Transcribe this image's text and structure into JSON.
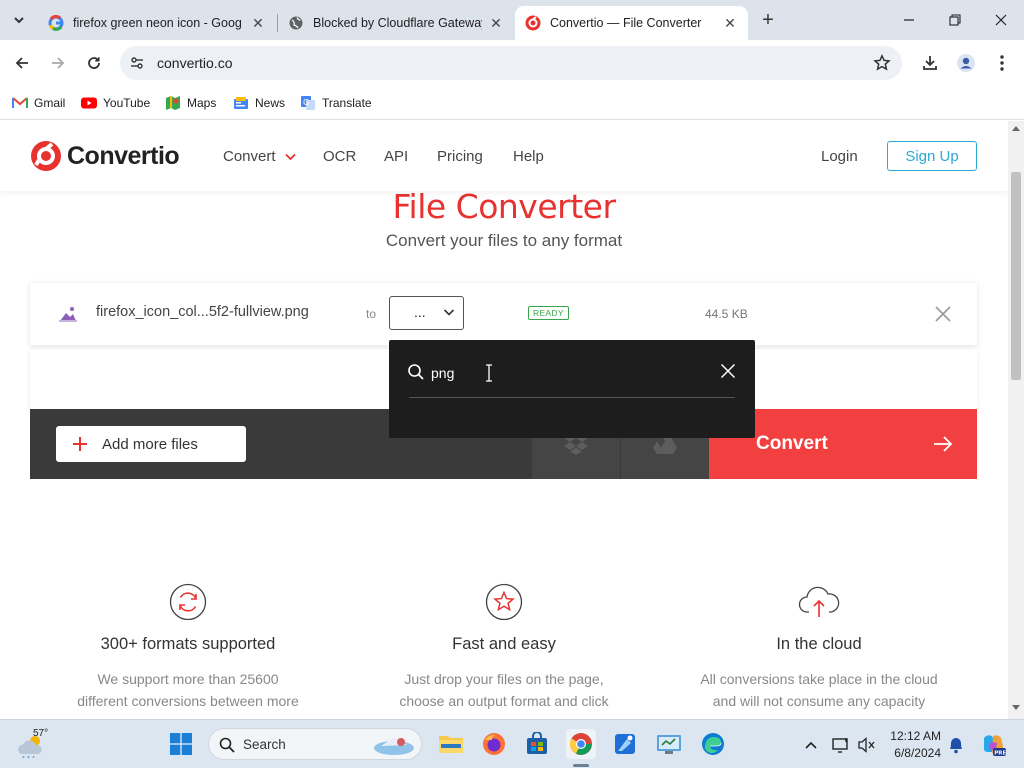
{
  "browser": {
    "tabs": [
      {
        "title": "firefox green neon icon - Goog",
        "favicon": "google-icon",
        "active": false
      },
      {
        "title": "Blocked by Cloudflare Gateway",
        "favicon": "globe-icon",
        "active": false
      },
      {
        "title": "Convertio — File Converter",
        "favicon": "convertio-icon",
        "active": true
      }
    ],
    "url": "convertio.co",
    "bookmarks": [
      {
        "label": "Gmail",
        "icon": "gmail-icon"
      },
      {
        "label": "YouTube",
        "icon": "youtube-icon"
      },
      {
        "label": "Maps",
        "icon": "maps-icon"
      },
      {
        "label": "News",
        "icon": "news-icon"
      },
      {
        "label": "Translate",
        "icon": "translate-icon"
      }
    ]
  },
  "site": {
    "brand": "Convertio",
    "nav": [
      "Convert",
      "OCR",
      "API",
      "Pricing",
      "Help"
    ],
    "login": "Login",
    "signup": "Sign Up",
    "hero_title": "File Converter",
    "hero_subtitle": "Convert your files to any format",
    "file": {
      "name": "firefox_icon_col...5f2-fullview.png",
      "to_label": "to",
      "format_value": "...",
      "status": "READY",
      "size": "44.5 KB"
    },
    "add_more": "Add more files",
    "convert": "Convert",
    "format_search": {
      "query": "png"
    },
    "features": [
      {
        "title": "300+ formats supported",
        "line1": "We support more than 25600",
        "line2": "different conversions between more",
        "icon": "refresh-circle-icon"
      },
      {
        "title": "Fast and easy",
        "line1": "Just drop your files on the page,",
        "line2": "choose an output format and click",
        "icon": "star-circle-icon"
      },
      {
        "title": "In the cloud",
        "line1": "All conversions take place in the cloud",
        "line2": "and will not consume any capacity",
        "icon": "cloud-upload-icon"
      }
    ]
  },
  "taskbar": {
    "weather_temp": "57°",
    "search_label": "Search",
    "time": "12:12 AM",
    "date": "6/8/2024"
  },
  "colors": {
    "brand_red": "#e8322f",
    "convert_red": "#f23f3f",
    "signup_blue": "#2aa9d6",
    "ready_green": "#3aa64a",
    "dark_bar": "#3a3a3a",
    "popup_bg": "#1d1d1d"
  }
}
